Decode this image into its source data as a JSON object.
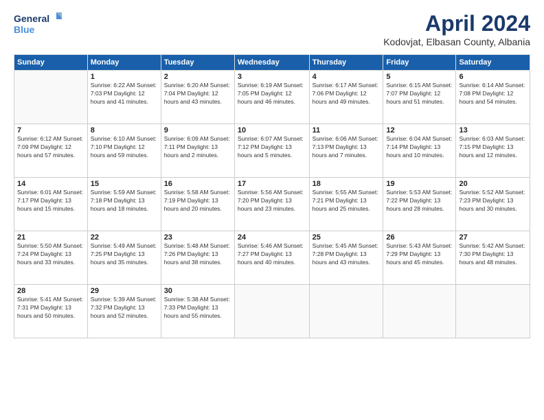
{
  "logo": {
    "line1": "General",
    "line2": "Blue"
  },
  "title": "April 2024",
  "location": "Kodovjat, Elbasan County, Albania",
  "weekdays": [
    "Sunday",
    "Monday",
    "Tuesday",
    "Wednesday",
    "Thursday",
    "Friday",
    "Saturday"
  ],
  "weeks": [
    [
      {
        "day": "",
        "info": ""
      },
      {
        "day": "1",
        "info": "Sunrise: 6:22 AM\nSunset: 7:03 PM\nDaylight: 12 hours\nand 41 minutes."
      },
      {
        "day": "2",
        "info": "Sunrise: 6:20 AM\nSunset: 7:04 PM\nDaylight: 12 hours\nand 43 minutes."
      },
      {
        "day": "3",
        "info": "Sunrise: 6:19 AM\nSunset: 7:05 PM\nDaylight: 12 hours\nand 46 minutes."
      },
      {
        "day": "4",
        "info": "Sunrise: 6:17 AM\nSunset: 7:06 PM\nDaylight: 12 hours\nand 49 minutes."
      },
      {
        "day": "5",
        "info": "Sunrise: 6:15 AM\nSunset: 7:07 PM\nDaylight: 12 hours\nand 51 minutes."
      },
      {
        "day": "6",
        "info": "Sunrise: 6:14 AM\nSunset: 7:08 PM\nDaylight: 12 hours\nand 54 minutes."
      }
    ],
    [
      {
        "day": "7",
        "info": "Sunrise: 6:12 AM\nSunset: 7:09 PM\nDaylight: 12 hours\nand 57 minutes."
      },
      {
        "day": "8",
        "info": "Sunrise: 6:10 AM\nSunset: 7:10 PM\nDaylight: 12 hours\nand 59 minutes."
      },
      {
        "day": "9",
        "info": "Sunrise: 6:09 AM\nSunset: 7:11 PM\nDaylight: 13 hours\nand 2 minutes."
      },
      {
        "day": "10",
        "info": "Sunrise: 6:07 AM\nSunset: 7:12 PM\nDaylight: 13 hours\nand 5 minutes."
      },
      {
        "day": "11",
        "info": "Sunrise: 6:06 AM\nSunset: 7:13 PM\nDaylight: 13 hours\nand 7 minutes."
      },
      {
        "day": "12",
        "info": "Sunrise: 6:04 AM\nSunset: 7:14 PM\nDaylight: 13 hours\nand 10 minutes."
      },
      {
        "day": "13",
        "info": "Sunrise: 6:03 AM\nSunset: 7:15 PM\nDaylight: 13 hours\nand 12 minutes."
      }
    ],
    [
      {
        "day": "14",
        "info": "Sunrise: 6:01 AM\nSunset: 7:17 PM\nDaylight: 13 hours\nand 15 minutes."
      },
      {
        "day": "15",
        "info": "Sunrise: 5:59 AM\nSunset: 7:18 PM\nDaylight: 13 hours\nand 18 minutes."
      },
      {
        "day": "16",
        "info": "Sunrise: 5:58 AM\nSunset: 7:19 PM\nDaylight: 13 hours\nand 20 minutes."
      },
      {
        "day": "17",
        "info": "Sunrise: 5:56 AM\nSunset: 7:20 PM\nDaylight: 13 hours\nand 23 minutes."
      },
      {
        "day": "18",
        "info": "Sunrise: 5:55 AM\nSunset: 7:21 PM\nDaylight: 13 hours\nand 25 minutes."
      },
      {
        "day": "19",
        "info": "Sunrise: 5:53 AM\nSunset: 7:22 PM\nDaylight: 13 hours\nand 28 minutes."
      },
      {
        "day": "20",
        "info": "Sunrise: 5:52 AM\nSunset: 7:23 PM\nDaylight: 13 hours\nand 30 minutes."
      }
    ],
    [
      {
        "day": "21",
        "info": "Sunrise: 5:50 AM\nSunset: 7:24 PM\nDaylight: 13 hours\nand 33 minutes."
      },
      {
        "day": "22",
        "info": "Sunrise: 5:49 AM\nSunset: 7:25 PM\nDaylight: 13 hours\nand 35 minutes."
      },
      {
        "day": "23",
        "info": "Sunrise: 5:48 AM\nSunset: 7:26 PM\nDaylight: 13 hours\nand 38 minutes."
      },
      {
        "day": "24",
        "info": "Sunrise: 5:46 AM\nSunset: 7:27 PM\nDaylight: 13 hours\nand 40 minutes."
      },
      {
        "day": "25",
        "info": "Sunrise: 5:45 AM\nSunset: 7:28 PM\nDaylight: 13 hours\nand 43 minutes."
      },
      {
        "day": "26",
        "info": "Sunrise: 5:43 AM\nSunset: 7:29 PM\nDaylight: 13 hours\nand 45 minutes."
      },
      {
        "day": "27",
        "info": "Sunrise: 5:42 AM\nSunset: 7:30 PM\nDaylight: 13 hours\nand 48 minutes."
      }
    ],
    [
      {
        "day": "28",
        "info": "Sunrise: 5:41 AM\nSunset: 7:31 PM\nDaylight: 13 hours\nand 50 minutes."
      },
      {
        "day": "29",
        "info": "Sunrise: 5:39 AM\nSunset: 7:32 PM\nDaylight: 13 hours\nand 52 minutes."
      },
      {
        "day": "30",
        "info": "Sunrise: 5:38 AM\nSunset: 7:33 PM\nDaylight: 13 hours\nand 55 minutes."
      },
      {
        "day": "",
        "info": ""
      },
      {
        "day": "",
        "info": ""
      },
      {
        "day": "",
        "info": ""
      },
      {
        "day": "",
        "info": ""
      }
    ]
  ]
}
